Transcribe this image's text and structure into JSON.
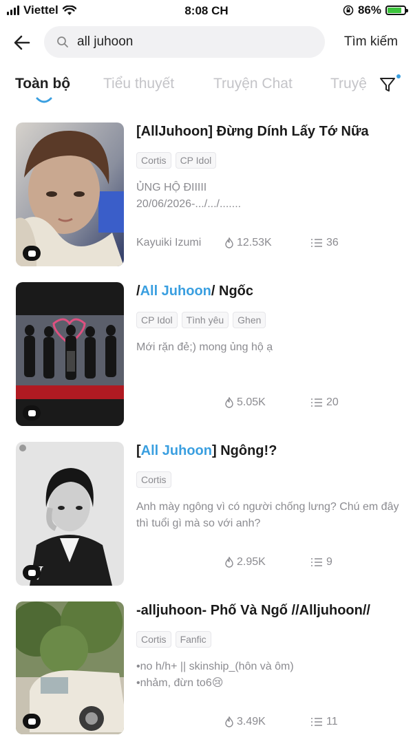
{
  "status_bar": {
    "carrier": "Viettel",
    "time": "8:08 CH",
    "battery": "86%",
    "battery_level": 0.86
  },
  "search": {
    "query": "all juhoon",
    "button_label": "Tìm kiếm"
  },
  "tabs": [
    {
      "label": "Toàn bộ",
      "active": true
    },
    {
      "label": "Tiểu thuyết",
      "active": false
    },
    {
      "label": "Truyện Chat",
      "active": false
    },
    {
      "label": "Truyệ",
      "active": false
    }
  ],
  "colors": {
    "accent": "#3a9fe0",
    "muted_text": "#8b8b90",
    "inactive_tab": "#c4c4c8"
  },
  "results": [
    {
      "title_pre": "[AllJuhoon] Đừng Dính Lấy Tớ Nữa",
      "title_hl": "",
      "title_post": "",
      "tags": [
        "Cortis",
        "CP Idol"
      ],
      "desc": "ỦNG HỘ ĐIIIII\n20/06/2026-.../.../.......",
      "author": "Kayuiki Izumi",
      "reads": "12.53K",
      "chapters": "36"
    },
    {
      "title_pre": "/",
      "title_hl": "All Juhoon",
      "title_post": "/ Ngốc",
      "tags": [
        "CP Idol",
        "Tình yêu",
        "Ghen"
      ],
      "desc": "Mới rặn đẻ;) mong ủng hộ ạ",
      "author": "",
      "reads": "5.05K",
      "chapters": "20"
    },
    {
      "title_pre": "[",
      "title_hl": "All Juhoon",
      "title_post": "] Ngông!?",
      "tags": [
        "Cortis"
      ],
      "desc": "Anh mày ngông vì có người chống lưng? Chú em đây thì tuổi gì mà so với anh?",
      "author": "",
      "reads": "2.95K",
      "chapters": "9"
    },
    {
      "title_pre": "-alljuhoon- Phố Và Ngố //Alljuhoon//",
      "title_hl": "",
      "title_post": "",
      "tags": [
        "Cortis",
        "Fanfic"
      ],
      "desc": "•no h/h+ || skinship_(hôn và ôm)\n•nhảm, đừn to6😢",
      "author": "",
      "reads": "3.49K",
      "chapters": "11"
    }
  ]
}
